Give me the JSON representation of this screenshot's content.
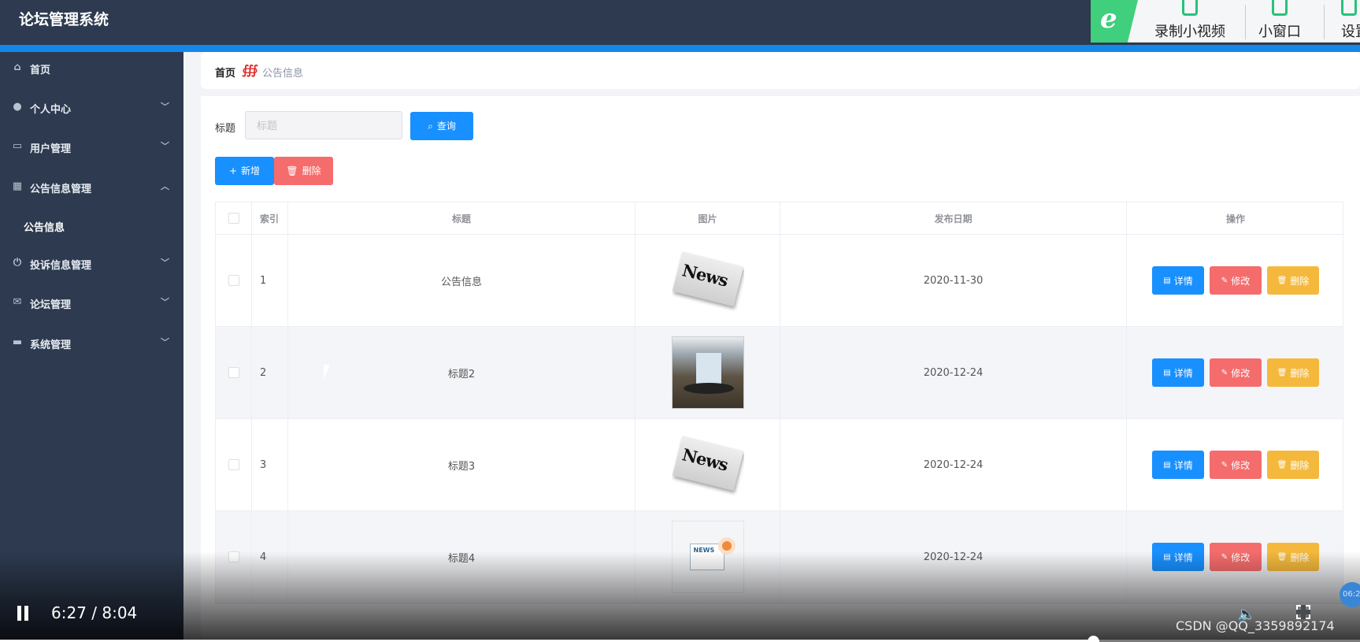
{
  "app": {
    "title": "论坛管理系统"
  },
  "recorder": {
    "record_label": "录制小视频",
    "window_label": "小窗口",
    "settings_label": "设置"
  },
  "sidebar": {
    "items": [
      {
        "label": "首页",
        "icon": "home-icon"
      },
      {
        "label": "个人中心",
        "icon": "user-icon"
      },
      {
        "label": "用户管理",
        "icon": "chat-icon"
      },
      {
        "label": "公告信息管理",
        "icon": "grid-icon"
      },
      {
        "label": "投诉信息管理",
        "icon": "power-icon"
      },
      {
        "label": "论坛管理",
        "icon": "mail-icon"
      },
      {
        "label": "系统管理",
        "icon": "monitor-icon"
      }
    ],
    "subitem": {
      "label": "公告信息"
    }
  },
  "breadcrumb": {
    "home": "首页",
    "current": "公告信息"
  },
  "search": {
    "label": "标题",
    "placeholder": "标题",
    "value": "",
    "query_label": "查询"
  },
  "toolbar": {
    "add_label": "新增",
    "delete_label": "删除"
  },
  "table": {
    "headers": {
      "index": "索引",
      "title": "标题",
      "image": "图片",
      "date": "发布日期",
      "ops": "操作"
    },
    "rows": [
      {
        "index": "1",
        "title": "公告信息",
        "image": "news-image",
        "date": "2020-11-30"
      },
      {
        "index": "2",
        "title": "标题2",
        "image": "meeting-room-image",
        "date": "2020-12-24"
      },
      {
        "index": "3",
        "title": "标题3",
        "image": "news-image",
        "date": "2020-12-24"
      },
      {
        "index": "4",
        "title": "标题4",
        "image": "news-illustration-image",
        "date": "2020-12-24"
      }
    ],
    "ops": {
      "detail": "详情",
      "edit": "修改",
      "delete": "删除"
    }
  },
  "video": {
    "time": "6:27 / 8:04",
    "progress": 0.8,
    "chip": "06:2"
  },
  "watermark": "CSDN @QQ_3359892174",
  "colors": {
    "sidebar_bg": "#2d3a4f",
    "accent": "#1890ff",
    "danger": "#f56c6c",
    "warning": "#f4b93c"
  }
}
